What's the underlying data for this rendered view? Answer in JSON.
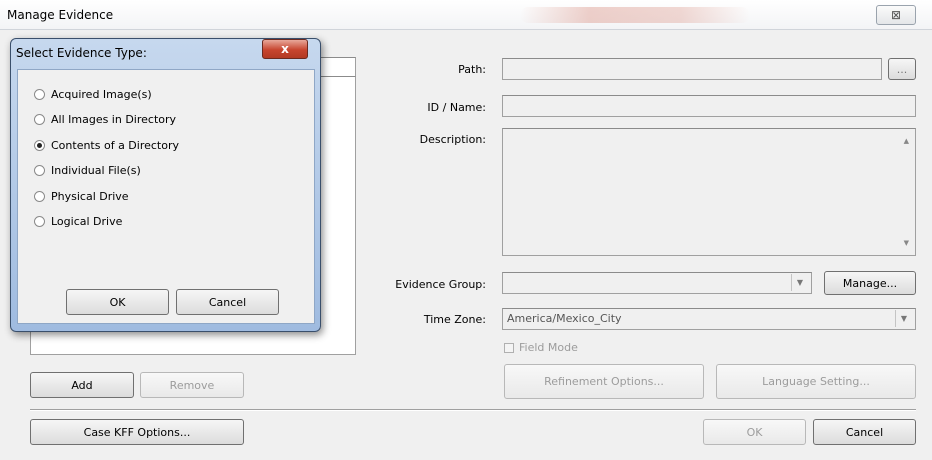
{
  "window": {
    "title": "Manage Evidence",
    "close_glyph": "⊠"
  },
  "form": {
    "path_label": "Path:",
    "path_value": "",
    "browse_label": "...",
    "id_label": "ID / Name:",
    "id_value": "",
    "description_label": "Description:",
    "description_value": "",
    "evidence_group_label": "Evidence Group:",
    "evidence_group_value": "",
    "manage_label": "Manage...",
    "time_zone_label": "Time Zone:",
    "time_zone_value": "America/Mexico_City",
    "field_mode_label": "Field Mode",
    "field_mode_checked": false,
    "refinement_label": "Refinement Options...",
    "language_label": "Language Setting..."
  },
  "left_panel": {
    "add_label": "Add",
    "remove_label": "Remove",
    "case_kff_label": "Case KFF Options..."
  },
  "footer": {
    "ok_label": "OK",
    "cancel_label": "Cancel"
  },
  "popup": {
    "title": "Select Evidence Type:",
    "close_glyph": "x",
    "options": [
      {
        "label": "Acquired Image(s)",
        "checked": false
      },
      {
        "label": "All Images in Directory",
        "checked": false
      },
      {
        "label": "Contents of a Directory",
        "checked": true
      },
      {
        "label": "Individual File(s)",
        "checked": false
      },
      {
        "label": "Physical Drive",
        "checked": false
      },
      {
        "label": "Logical Drive",
        "checked": false
      }
    ],
    "ok_label": "OK",
    "cancel_label": "Cancel"
  },
  "colors": {
    "popup_frame": "#b3cbe9",
    "popup_close": "#c7452f",
    "window_bg": "#f0f0f0"
  }
}
